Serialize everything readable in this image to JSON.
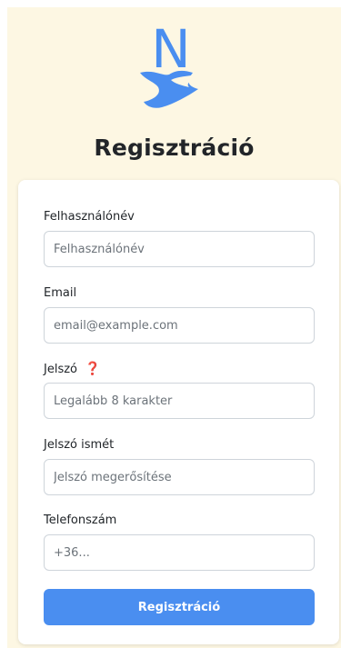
{
  "header": {
    "logo_letter": "N",
    "title": "Regisztráció"
  },
  "form": {
    "fields": [
      {
        "label": "Felhasználónév",
        "placeholder": "Felhasználónév",
        "value": ""
      },
      {
        "label": "Email",
        "placeholder": "email@example.com",
        "value": ""
      },
      {
        "label": "Jelszó",
        "placeholder": "Legalább 8 karakter",
        "value": "",
        "help_icon": "❓"
      },
      {
        "label": "Jelszó ismét",
        "placeholder": "Jelszó megerősítése",
        "value": ""
      },
      {
        "label": "Telefonszám",
        "placeholder": "+36...",
        "value": ""
      }
    ],
    "submit_label": "Regisztráció"
  },
  "colors": {
    "page_background": "#fdf7e3",
    "accent": "#4a8ef0",
    "help_icon": "#d6152f"
  }
}
